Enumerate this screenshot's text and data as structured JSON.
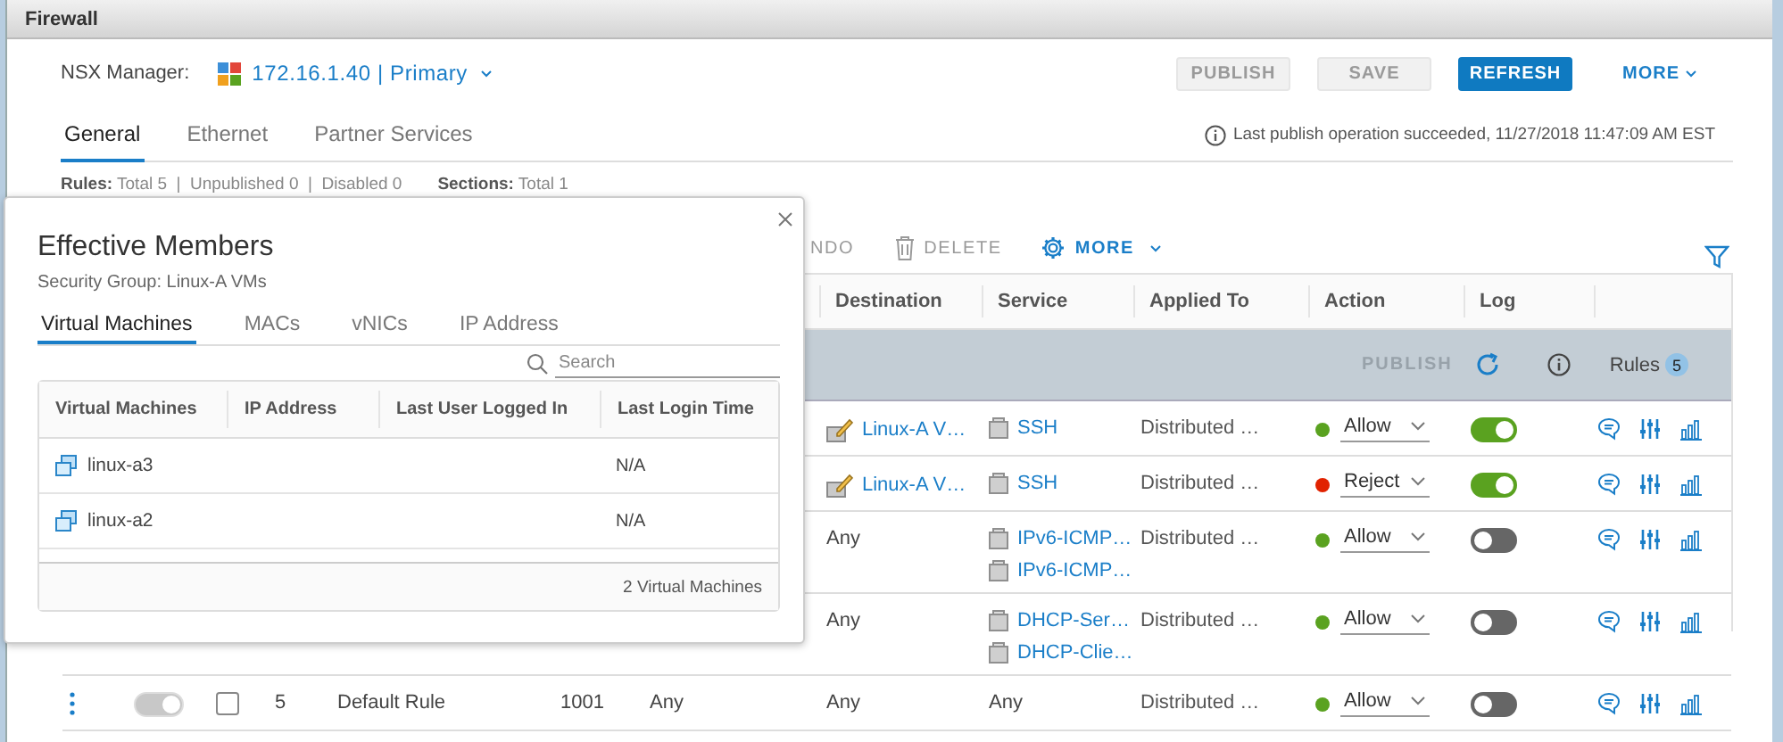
{
  "window": {
    "title": "Firewall"
  },
  "manager": {
    "label": "NSX Manager:",
    "value": "172.16.1.40 | Primary"
  },
  "buttons": [
    {
      "label": "PUBLISH",
      "kind": "disabled"
    },
    {
      "label": "SAVE",
      "kind": "disabled"
    },
    {
      "label": "REFRESH",
      "kind": "primary"
    },
    {
      "label": "MORE",
      "kind": "menu"
    }
  ],
  "tabs": [
    {
      "label": "General",
      "selected": true
    },
    {
      "label": "Ethernet",
      "selected": false
    },
    {
      "label": "Partner Services",
      "selected": false
    }
  ],
  "publish_status": "Last publish operation succeeded, 11/27/2018 11:47:09 AM EST",
  "stats": [
    {
      "label": "Rules:",
      "value": "Total 5  |  Unpublished 0  |  Disabled 0"
    },
    {
      "label": "Sections:",
      "value": "Total 1"
    }
  ],
  "toolbar": [
    {
      "label": "NDO",
      "kind": "plain",
      "disabled": true
    },
    {
      "label": "DELETE",
      "kind": "delete",
      "disabled": true
    },
    {
      "label": "MORE",
      "kind": "gear",
      "disabled": false
    }
  ],
  "table": {
    "columns": [
      "Destination",
      "Service",
      "Applied To",
      "Action",
      "Log"
    ],
    "section": {
      "publish": "PUBLISH",
      "rules_label": "Rules",
      "rules_count": "5"
    },
    "rules": [
      {
        "destination": {
          "text": "Linux-A V…",
          "kind": "group"
        },
        "services": [
          {
            "text": "SSH",
            "kind": "service"
          }
        ],
        "applied_to": "Distributed …",
        "action": "Allow",
        "color": "#5aa220",
        "log": true
      },
      {
        "destination": {
          "text": "Linux-A V…",
          "kind": "group"
        },
        "services": [
          {
            "text": "SSH",
            "kind": "service"
          }
        ],
        "applied_to": "Distributed …",
        "action": "Reject",
        "color": "#e12200",
        "log": true
      },
      {
        "destination": {
          "text": "Any",
          "kind": "any"
        },
        "services": [
          {
            "text": "IPv6-ICMP…",
            "kind": "service"
          },
          {
            "text": "IPv6-ICMP…",
            "kind": "service"
          }
        ],
        "applied_to": "Distributed …",
        "action": "Allow",
        "color": "#5aa220",
        "log": false
      },
      {
        "destination": {
          "text": "Any",
          "kind": "any"
        },
        "services": [
          {
            "text": "DHCP-Ser…",
            "kind": "service"
          },
          {
            "text": "DHCP-Clie…",
            "kind": "service"
          }
        ],
        "applied_to": "Distributed …",
        "action": "Allow",
        "color": "#5aa220",
        "log": false
      },
      {
        "enabled": true,
        "checked": false,
        "number": "5",
        "name": "Default Rule",
        "id": "1001",
        "source": "Any",
        "destination": {
          "text": "Any",
          "kind": "any"
        },
        "services": [
          {
            "text": "Any",
            "kind": "any"
          }
        ],
        "applied_to": "Distributed …",
        "action": "Allow",
        "color": "#5aa220",
        "log": false
      }
    ]
  },
  "popover": {
    "title": "Effective Members",
    "subtitle": "Security Group: Linux-A VMs",
    "tabs": [
      {
        "label": "Virtual Machines",
        "selected": true
      },
      {
        "label": "MACs",
        "selected": false
      },
      {
        "label": "vNICs",
        "selected": false
      },
      {
        "label": "IP Address",
        "selected": false
      }
    ],
    "search": {
      "placeholder": "Search"
    },
    "columns": [
      "Virtual Machines",
      "IP Address",
      "Last User Logged In",
      "Last Login Time"
    ],
    "rows": [
      {
        "name": "linux-a3",
        "last_login_time": "N/A"
      },
      {
        "name": "linux-a2",
        "last_login_time": "N/A"
      }
    ],
    "footer": "2 Virtual Machines"
  }
}
